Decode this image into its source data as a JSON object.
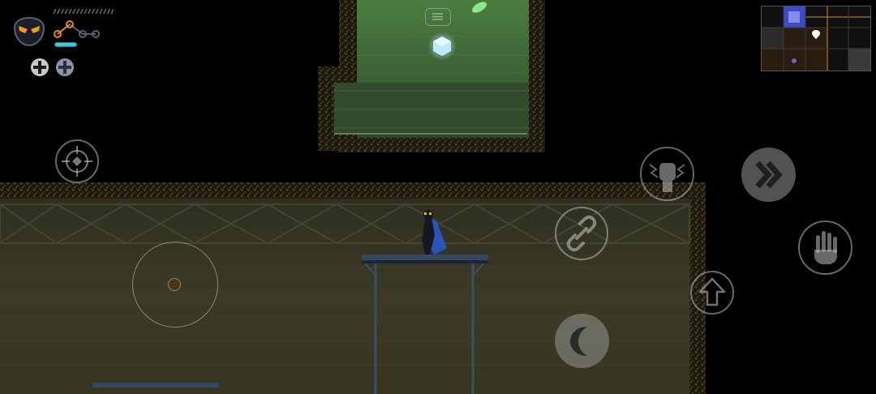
{
  "hud": {
    "portrait_icon": "ninja-mask-portrait-icon",
    "health": {
      "filled_segments": 0,
      "total_segments": 16
    },
    "skill_nodes": {
      "unlocked": 2,
      "total": 4
    },
    "energy_level": 1.0,
    "heal_charges": {
      "total": 2,
      "icon": "plus-cross-icon"
    }
  },
  "controls": {
    "menu_button_icon": "menu-lines-icon",
    "target_button_icon": "crosshair-icon",
    "joystick_icon": "virtual-joystick",
    "chain_button_icon": "chain-link-icon",
    "power_fist_button_icon": "power-fist-icon",
    "dash_button_icon": "double-chevron-right-icon",
    "grab_button_icon": "open-hand-icon",
    "jump_button_icon": "up-arrow-icon",
    "crescent_button_icon": "crescent-moon-icon"
  },
  "minimap": {
    "cols": 5,
    "rows": 3,
    "player_marker_icon": "map-pin-icon",
    "objective_marker_icon": "purple-dot-icon"
  },
  "colors": {
    "accent_orange": "#e08a2a",
    "energy_cyan": "#40c8d8",
    "cloak_blue": "#2a54b8",
    "upper_room_green": "#3d6a35",
    "lower_room_olive": "#3a3a26"
  }
}
